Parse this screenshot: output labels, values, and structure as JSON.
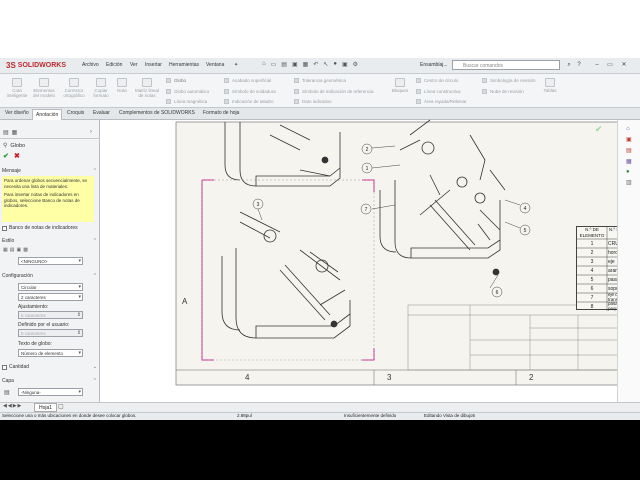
{
  "app": {
    "logo_ds": "3S",
    "logo_text": "SOLIDWORKS"
  },
  "menu": [
    "Archivo",
    "Edición",
    "Ver",
    "Insertar",
    "Herramientas",
    "Ventana"
  ],
  "doc_title": "Ensamblaj...",
  "search": {
    "placeholder": "Buscar comandos"
  },
  "ribbon": {
    "big_buttons": [
      "Cota inteligente",
      "Elementos del modelo",
      "Corrector ortográfico",
      "Copiar formato",
      "Nota",
      "Matriz lineal de notas"
    ],
    "col1": [
      "Globo",
      "Globo automático",
      "Línea magnética"
    ],
    "col2": [
      "Acabado superficial",
      "Símbolo de soldadura",
      "Indicación de taladro"
    ],
    "col3": [
      "Tolerancia geométrica",
      "Símbolo de indicación de referencia",
      "Dato indicativo"
    ],
    "col4": [
      "Centro de círculo",
      "Línea constructiva",
      "Área rayada/Rellenar"
    ],
    "col5": [
      "Simbología de revisión",
      "Nube de revisión"
    ],
    "bloques": "Bloques",
    "tablas": "Tablas"
  },
  "tabs": [
    "Ver diseño",
    "Anotación",
    "Croquis",
    "Evaluar",
    "Complementos de SOLIDWORKS",
    "Formato de hoja"
  ],
  "active_tab": "Anotación",
  "panel": {
    "title": "Globo",
    "mensaje_label": "Mensaje",
    "mensaje_p1": "Para ordenar globos secuencialmente, se necesita una lista de materiales.",
    "mensaje_p2": "Para insertar notas de indicadores en globos, seleccione Banco de notas de indicadores.",
    "banco_label": "Banco de notas de indicadores",
    "estilo_label": "Estilo",
    "estilo_value": "<NINGUNO>",
    "config_label": "Configuración",
    "forma_value": "Circular",
    "tamano_value": "2 caracteres",
    "ajustar_label": "Ajustamiento:",
    "ajustar_value": "5 caracteres",
    "definido_label": "Definido por el usuario:",
    "definido_value": "5 caracteres",
    "texto_label": "Texto de globo:",
    "texto_value": "Número de elemento",
    "cantidad_label": "Cantidad",
    "capa_label": "Capa",
    "capa_value": "-Ninguna-"
  },
  "sheet": {
    "zone_a": "A",
    "zone_4": "4",
    "zone_3": "3",
    "zone_2": "2"
  },
  "bom": {
    "headers": [
      "N.º DE ELEMENTO",
      "N.º DE PIEZA"
    ],
    "rows": [
      [
        "1",
        "CRUCETA"
      ],
      [
        "2",
        "horquilla"
      ],
      [
        "3",
        "eje"
      ],
      [
        "4",
        "arandela"
      ],
      [
        "5",
        "pasador"
      ],
      [
        "6",
        "soporte"
      ],
      [
        "7",
        "eje de transmisión"
      ],
      [
        "8",
        "pasador pequeño"
      ]
    ]
  },
  "balloons_view1": [
    "1",
    "2",
    "3",
    "4",
    "5",
    "6",
    "7",
    "8"
  ],
  "balloon_view2": "3",
  "sheet_tab": "Hoja1",
  "status": {
    "message": "Seleccione una o más ubicaciones en donde desee colocar globos.",
    "coord": "2.88pul",
    "defined": "Insuficientemente definido",
    "editing": "Editando Vista de dibujo5"
  }
}
